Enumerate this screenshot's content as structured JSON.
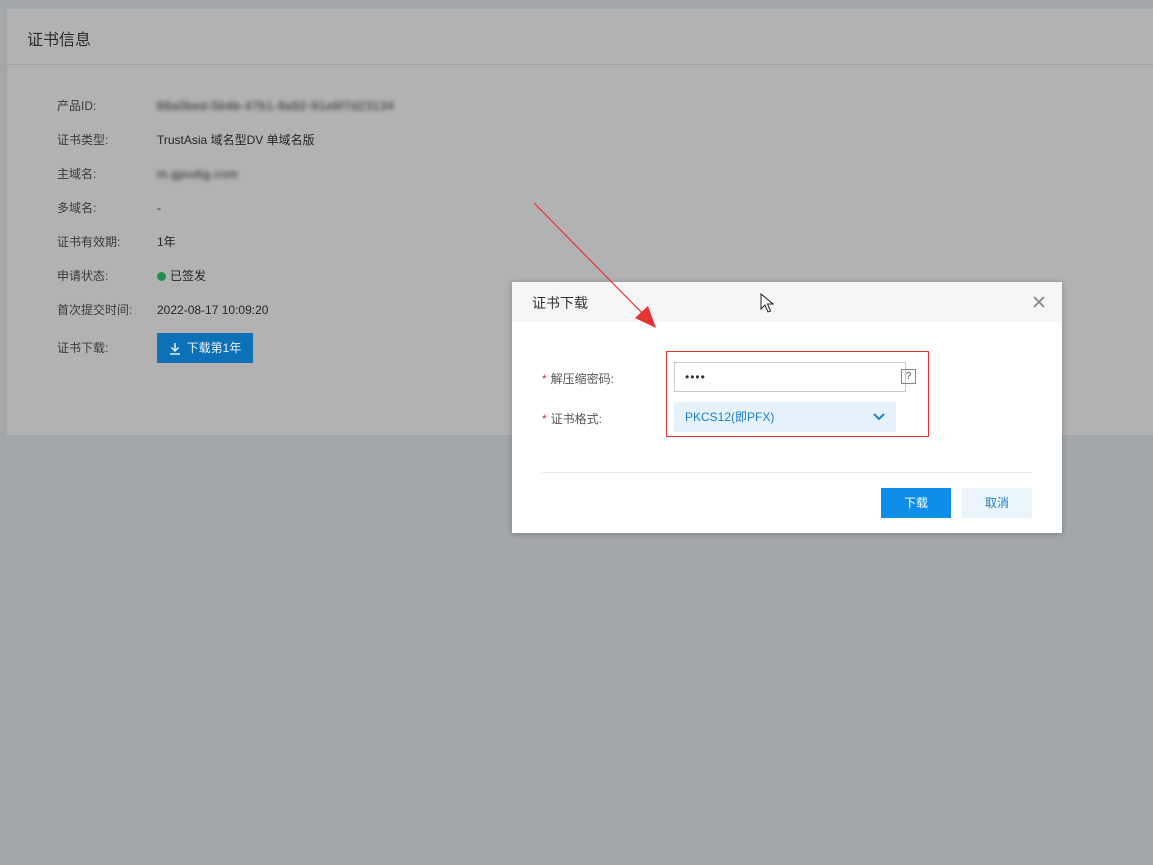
{
  "panel": {
    "title": "证书信息",
    "rows": [
      {
        "label": "产品ID:",
        "value": "88a0bed-5b4b-47b1-9a92-91e8f7d23134",
        "blurred": true
      },
      {
        "label": "证书类型:",
        "value": "TrustAsia 域名型DV 单域名版"
      },
      {
        "label": "主域名:",
        "value": "m.gpudig.com",
        "blurred": true
      },
      {
        "label": "多域名:",
        "value": "-"
      },
      {
        "label": "证书有效期:",
        "value": "1年"
      },
      {
        "label": "申请状态:",
        "value": "已签发"
      },
      {
        "label": "首次提交时间:",
        "value": "2022-08-17 10:09:20"
      },
      {
        "label": "证书下载:"
      }
    ],
    "download_button": "下载第1年"
  },
  "modal": {
    "title": "证书下载",
    "password_label": "解压缩密码:",
    "password_value": "••••",
    "help_mark": "?",
    "format_label": "证书格式:",
    "format_value": "PKCS12(即PFX)",
    "confirm_button": "下载",
    "cancel_button": "取消"
  },
  "colors": {
    "primary": "#0e8ee9",
    "status_green": "#1f8f4b",
    "annotation_red": "#e63333"
  },
  "icons": {
    "download": "download-icon",
    "close": "close-icon",
    "chevron": "chevron-down-icon",
    "status": "status-dot-icon"
  }
}
